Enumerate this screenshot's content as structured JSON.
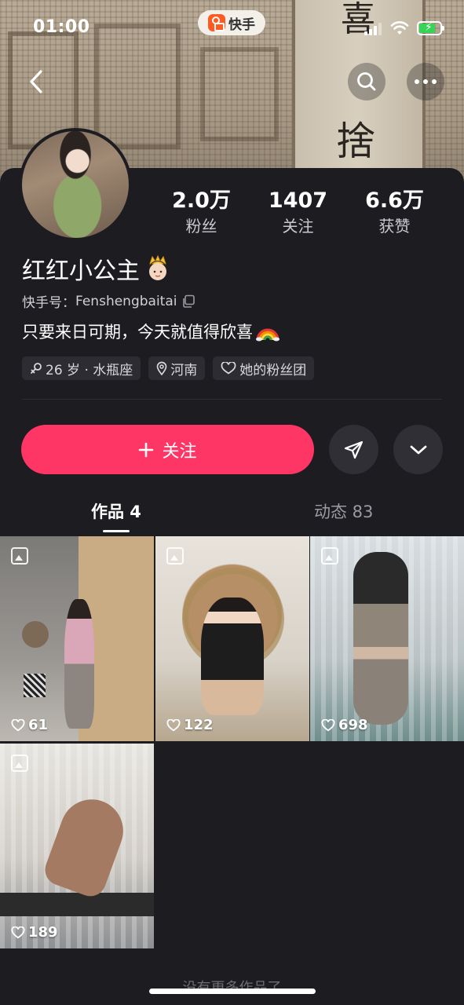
{
  "status_bar": {
    "time": "01:00",
    "app_name": "快手"
  },
  "header": {
    "back_icon": "chevron-left-icon",
    "search_icon": "search-icon",
    "more_icon": "more-horizontal-icon"
  },
  "profile": {
    "stats": [
      {
        "value": "2.0万",
        "label": "粉丝"
      },
      {
        "value": "1407",
        "label": "关注"
      },
      {
        "value": "6.6万",
        "label": "获赞"
      }
    ],
    "nickname": "红红小公主",
    "kuaishou_id_label": "快手号：",
    "kuaishou_id": "Fenshengbaitai",
    "bio": "只要来日可期，今天就值得欣喜",
    "tags": [
      {
        "icon": "gender-female-icon",
        "text": "26 岁 · 水瓶座"
      },
      {
        "icon": "location-pin-icon",
        "text": "河南"
      },
      {
        "icon": "heart-outline-icon",
        "text": "她的粉丝团"
      }
    ]
  },
  "actions": {
    "follow_label": "关注",
    "share_icon": "send-icon",
    "expand_icon": "chevron-down-icon"
  },
  "tabs": [
    {
      "label": "作品 4",
      "active": true
    },
    {
      "label": "动态 83",
      "active": false
    }
  ],
  "posts": [
    {
      "likes": "61"
    },
    {
      "likes": "122"
    },
    {
      "likes": "698"
    },
    {
      "likes": "189"
    }
  ],
  "footer": {
    "no_more_text": "没有更多作品了"
  },
  "colors": {
    "background": "#1c1c21",
    "follow_button": "#fe3666",
    "tag_background": "#2c2c32"
  }
}
